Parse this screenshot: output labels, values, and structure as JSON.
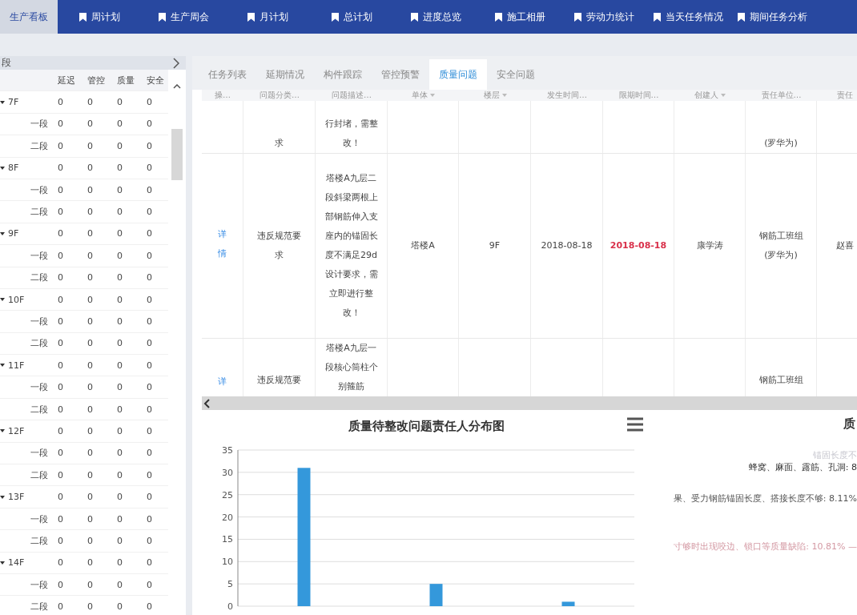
{
  "top_nav": [
    {
      "label": "生产看板",
      "selected": true
    },
    {
      "label": "周计划",
      "selected": false
    },
    {
      "label": "生产周会",
      "selected": false
    },
    {
      "label": "月计划",
      "selected": false
    },
    {
      "label": "总计划",
      "selected": false
    },
    {
      "label": "进度总览",
      "selected": false
    },
    {
      "label": "施工相册",
      "selected": false
    },
    {
      "label": "劳动力统计",
      "selected": false
    },
    {
      "label": "当天任务情况",
      "selected": false
    },
    {
      "label": "期间任务分析",
      "selected": false
    }
  ],
  "side_panel": {
    "title": "段",
    "columns": [
      "延迟",
      "管控",
      "质量",
      "安全"
    ],
    "floors": [
      {
        "label": "7F",
        "expanded": true,
        "values": [
          "0",
          "0",
          "0",
          "0"
        ],
        "children": [
          {
            "label": "一段",
            "values": [
              "0",
              "0",
              "0",
              "0"
            ]
          },
          {
            "label": "二段",
            "values": [
              "0",
              "0",
              "0",
              "0"
            ]
          }
        ]
      },
      {
        "label": "8F",
        "expanded": true,
        "values": [
          "0",
          "0",
          "0",
          "0"
        ],
        "children": [
          {
            "label": "一段",
            "values": [
              "0",
              "0",
              "0",
              "0"
            ]
          },
          {
            "label": "二段",
            "values": [
              "0",
              "0",
              "0",
              "0"
            ]
          }
        ]
      },
      {
        "label": "9F",
        "expanded": true,
        "values": [
          "0",
          "0",
          "0",
          "0"
        ],
        "children": [
          {
            "label": "一段",
            "values": [
              "0",
              "0",
              "0",
              "0"
            ]
          },
          {
            "label": "二段",
            "values": [
              "0",
              "0",
              "0",
              "0"
            ]
          }
        ]
      },
      {
        "label": "10F",
        "expanded": true,
        "values": [
          "0",
          "0",
          "0",
          "0"
        ],
        "children": [
          {
            "label": "一段",
            "values": [
              "0",
              "0",
              "0",
              "0"
            ]
          },
          {
            "label": "二段",
            "values": [
              "0",
              "0",
              "0",
              "0"
            ]
          }
        ]
      },
      {
        "label": "11F",
        "expanded": true,
        "values": [
          "0",
          "0",
          "0",
          "0"
        ],
        "children": [
          {
            "label": "一段",
            "values": [
              "0",
              "0",
              "0",
              "0"
            ]
          },
          {
            "label": "二段",
            "values": [
              "0",
              "0",
              "0",
              "0"
            ]
          }
        ]
      },
      {
        "label": "12F",
        "expanded": true,
        "values": [
          "0",
          "0",
          "0",
          "0"
        ],
        "children": [
          {
            "label": "一段",
            "values": [
              "0",
              "0",
              "0",
              "0"
            ]
          },
          {
            "label": "二段",
            "values": [
              "0",
              "0",
              "0",
              "0"
            ]
          }
        ]
      },
      {
        "label": "13F",
        "expanded": true,
        "values": [
          "0",
          "0",
          "0",
          "0"
        ],
        "children": [
          {
            "label": "一段",
            "values": [
              "0",
              "0",
              "0",
              "0"
            ]
          },
          {
            "label": "二段",
            "values": [
              "0",
              "0",
              "0",
              "0"
            ]
          }
        ]
      },
      {
        "label": "14F",
        "expanded": true,
        "values": [
          "0",
          "0",
          "0",
          "0"
        ],
        "children": [
          {
            "label": "一段",
            "values": [
              "0",
              "0",
              "0",
              "0"
            ]
          },
          {
            "label": "二段",
            "values": [
              "0",
              "0",
              "0",
              "0"
            ]
          }
        ]
      }
    ]
  },
  "tabs": [
    {
      "label": "任务列表",
      "selected": false
    },
    {
      "label": "延期情况",
      "selected": false
    },
    {
      "label": "构件跟踪",
      "selected": false
    },
    {
      "label": "管控预警",
      "selected": false
    },
    {
      "label": "质量问题",
      "selected": true
    },
    {
      "label": "安全问题",
      "selected": false
    }
  ],
  "table": {
    "columns": [
      "操…",
      "问题分类…",
      "问题描述…",
      "单体",
      "楼层",
      "发生时间…",
      "限期时间…",
      "创建人",
      "责任单位…",
      "责任"
    ],
    "rows": [
      {
        "cells": [
          "",
          "求",
          "行封堵，需整改！",
          "",
          "",
          "",
          "",
          "",
          "(罗华为)",
          ""
        ]
      },
      {
        "overdue": true,
        "cells": [
          "详情",
          "违反规范要求",
          "塔楼A九层二段斜梁两根上部钢筋伸入支座内的锚固长度不满足29d设计要求，需立即进行整改！",
          "塔楼A",
          "9F",
          "2018-08-18",
          "2018-08-18",
          "康学涛",
          "钢筋工班组(罗华为)",
          "赵喜"
        ]
      },
      {
        "cells": [
          "详",
          "违反规范要",
          "塔楼A九层一段核心筒柱个别箍筋",
          "",
          "",
          "",
          "",
          "",
          "钢筋工班组",
          ""
        ]
      }
    ]
  },
  "bar_chart": {
    "chart_data": {
      "type": "bar",
      "title": "质量待整改问题责任人分布图",
      "grid": true,
      "values": [
        31,
        5,
        1
      ],
      "ylim": [
        0,
        35
      ],
      "yticks": [
        0,
        5,
        10,
        15,
        20,
        25,
        30,
        35
      ]
    }
  },
  "pie_panel": {
    "title": "质",
    "labels": [
      {
        "text": "锚固长度不",
        "color": "#c8c8d0"
      },
      {
        "text": "蜂窝、麻面、露筋、孔洞: 8",
        "color": "#333333"
      },
      {
        "text": "果、受力钢筋锚固长度、搭接长度不够: 8.11%",
        "color": "#555555"
      },
      {
        "text": "寸够时出现咬边、锁口等质量缺陷: 10.81% —",
        "color": "#d49aa4"
      }
    ]
  }
}
